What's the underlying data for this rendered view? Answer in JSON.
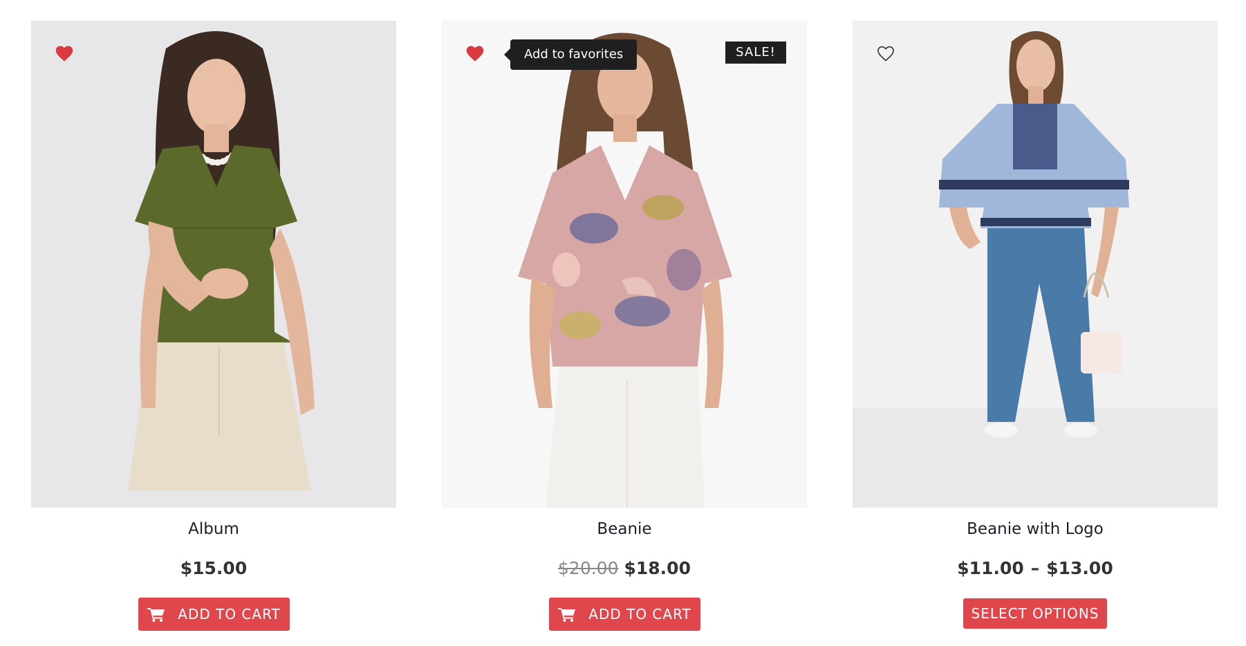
{
  "products": [
    {
      "title": "Album",
      "price": "$15.00",
      "button_label": "ADD TO CART",
      "favorited": true,
      "icon": "cart-icon"
    },
    {
      "title": "Beanie",
      "old_price": "$20.00",
      "price": "$18.00",
      "button_label": "ADD TO CART",
      "favorited": true,
      "sale_badge": "SALE!",
      "tooltip": "Add to favorites",
      "icon": "cart-icon"
    },
    {
      "title": "Beanie with Logo",
      "price_min": "$11.00",
      "price_sep": "–",
      "price_max": "$13.00",
      "button_label": "SELECT OPTIONS",
      "favorited": false
    }
  ],
  "colors": {
    "accent": "#e0474c",
    "heart": "#d9393f",
    "tooltip_bg": "#1f1f1f",
    "text": "#1d1d2b"
  }
}
